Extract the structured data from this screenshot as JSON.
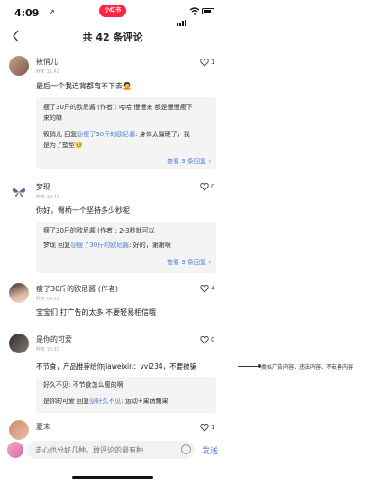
{
  "status_bar": {
    "time": "4:09",
    "location_arrow": "↗",
    "app_pill": "小红书"
  },
  "header": {
    "title": "共 42 条评论",
    "back_icon": "chevron-left-icon"
  },
  "comments": [
    {
      "user": "筱俏儿",
      "time": "昨天 11:42",
      "likes": "1",
      "text": "最后一个我连背都弯不下去🤦",
      "replies": [
        {
          "user": "瘦了30斤的欧尼酱 (作者):",
          "text": " 哈哈 慢慢来 都是慢慢瘦下"
        },
        {
          "user": "",
          "text": "来的嘛"
        },
        {
          "user": "筱俏儿",
          "mid": " 回复",
          "at": "@瘦了30斤的欧尼酱",
          "text": ": 身体太僵硬了，我"
        },
        {
          "user": "",
          "text": "是为了塑型🥺"
        }
      ],
      "more": "查看 3 条回复 ›"
    },
    {
      "user": "梦现",
      "time": "昨天 13:49",
      "likes": "0",
      "text": "你好，臀桥一个坚持多少秒呢",
      "replies": [
        {
          "user": "瘦了30斤的欧尼酱 (作者):",
          "text": " 2-3秒就可以"
        },
        {
          "user": "梦现",
          "mid": " 回复",
          "at": "@瘦了30斤的欧尼酱",
          "text": ": 好的，谢谢啊"
        }
      ],
      "more": "查看 3 条回复 ›"
    },
    {
      "user": "瘦了30斤的欧尼酱 (作者)",
      "time": "昨天 06:51",
      "likes": "4",
      "text": "宝宝们 打广告的太多 不要轻易相信哦"
    },
    {
      "user": "是你的可爱",
      "time": "昨天 13:10",
      "likes": "0",
      "text": "不节食，产品推荐给你jiaweixin：vvi234，不要被骗",
      "replies": [
        {
          "user": "好久不见:",
          "text": " 不节食怎么瘦的啊"
        },
        {
          "user": "是你的可爱",
          "mid": " 回复",
          "at": "@好久不见",
          "text": ": 运动+果蔬糖果"
        }
      ]
    },
    {
      "user": "夏末",
      "likes": "1"
    }
  ],
  "annotation": "类似广告内容、违法内容、不友善内容",
  "bottom_bar": {
    "placeholder": "走心也分好几种，敢评论的最有种",
    "send": "发送"
  }
}
